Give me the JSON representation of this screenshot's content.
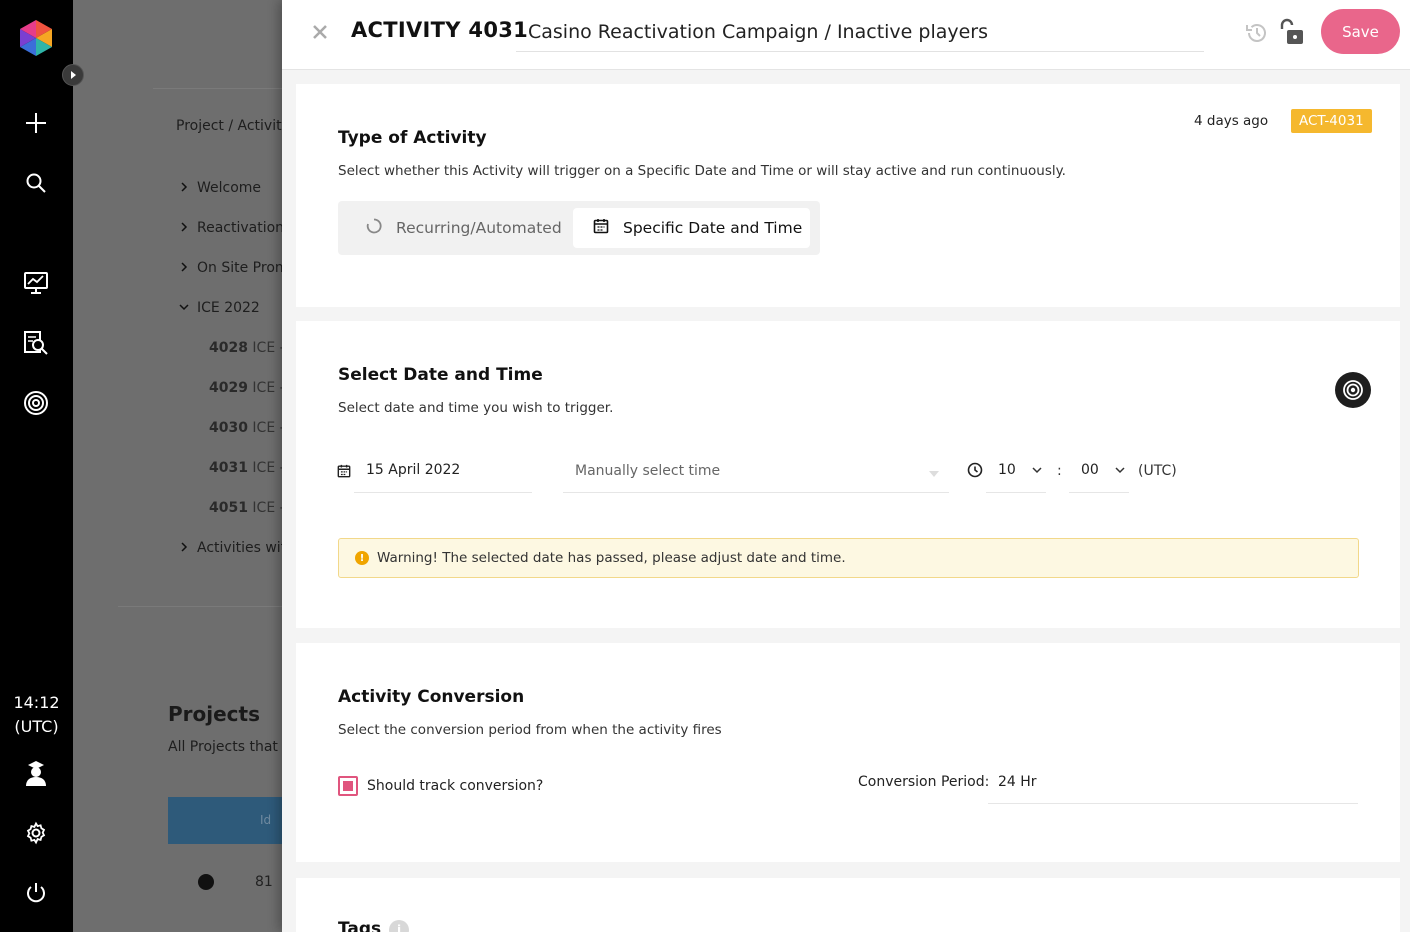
{
  "rail": {
    "time": "14:12",
    "timezone": "(UTC)",
    "icons": [
      "plus-icon",
      "search-icon",
      "dashboard-chart-icon",
      "report-search-icon",
      "target-icon",
      "user-icon",
      "gear-icon",
      "power-icon"
    ]
  },
  "background": {
    "breadcrumb": "Project / Activiti",
    "nav": [
      "Welcome",
      "Reactivation",
      "On Site Prom",
      "ICE 2022",
      "Activities wit"
    ],
    "sub_items": [
      {
        "id": "4028",
        "name": "ICE -"
      },
      {
        "id": "4029",
        "name": "ICE -"
      },
      {
        "id": "4030",
        "name": "ICE -"
      },
      {
        "id": "4031",
        "name": "ICE -"
      },
      {
        "id": "4051",
        "name": "ICE -"
      }
    ],
    "projects_title": "Projects",
    "projects_sub": "All Projects that i",
    "table_header": "Id",
    "row_id": "81"
  },
  "header": {
    "title": "ACTIVITY 4031",
    "name": "Casino Reactivation Campaign / Inactive players",
    "save_label": "Save"
  },
  "type_card": {
    "title": "Type of Activity",
    "description": "Select whether this Activity will trigger on a Specific Date and Time or will stay active and run continuously.",
    "updated": "4 days ago",
    "badge": "ACT-4031",
    "options": [
      {
        "label": "Recurring/Automated",
        "selected": false
      },
      {
        "label": "Specific Date and Time",
        "selected": true
      }
    ]
  },
  "date_card": {
    "title": "Select Date and Time",
    "description": "Select date and time you wish to trigger.",
    "date": "15 April 2022",
    "time_mode_placeholder": "Manually select time",
    "hour": "10",
    "separator": ":",
    "minute": "00",
    "timezone": "(UTC)",
    "warning": "Warning! The selected date has passed, please adjust date and time."
  },
  "conversion_card": {
    "title": "Activity Conversion",
    "description": "Select the conversion period from when the activity fires",
    "checkbox_label": "Should track conversion?",
    "checked": true,
    "period_label": "Conversion Period:",
    "period_value": "24 Hr"
  },
  "tags_card": {
    "title": "Tags"
  },
  "colors": {
    "accent": "#e9668b",
    "badge": "#f5b82e",
    "warning_bg": "#fdf8e2",
    "rail": "#000000"
  }
}
